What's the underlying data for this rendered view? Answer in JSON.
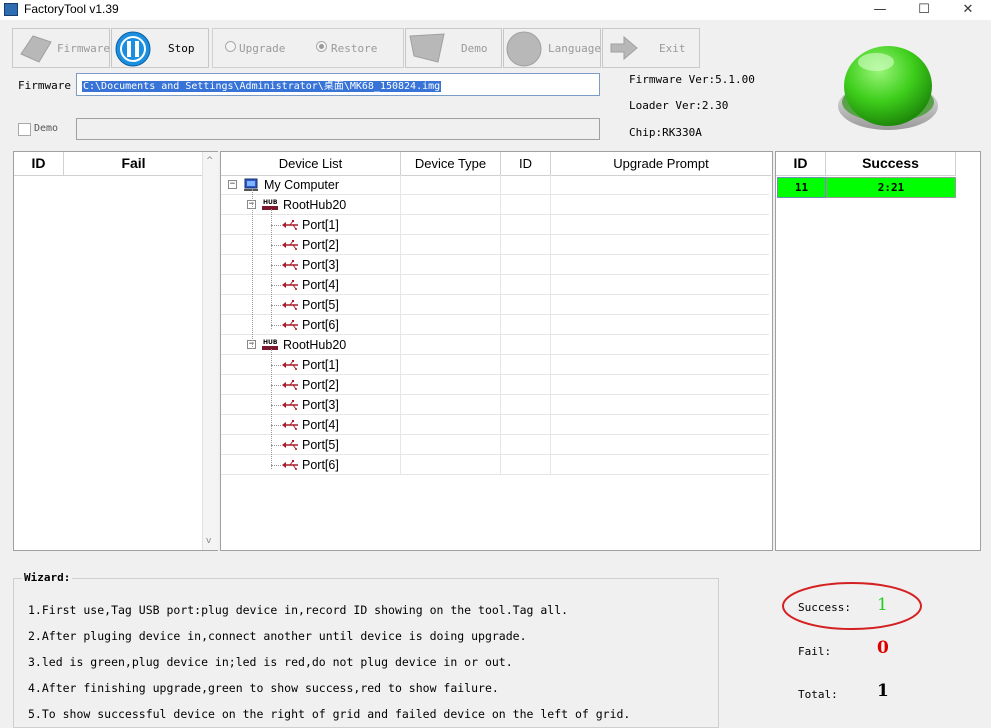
{
  "window": {
    "title": "FactoryTool v1.39",
    "minimize": "—",
    "maximize": "☐",
    "close": "✕"
  },
  "toolbar": {
    "firmware": "Firmware",
    "stop": "Stop",
    "upgrade": "Upgrade",
    "restore": "Restore",
    "demo": "Demo",
    "language": "Language",
    "exit": "Exit",
    "selected_mode": "Restore"
  },
  "firmware_field": {
    "label": "Firmware",
    "value": "C:\\Documents and Settings\\Administrator\\桌面\\MK68_150824.img"
  },
  "demo_field": {
    "label": "Demo",
    "checked": false,
    "value": ""
  },
  "info": {
    "firmware_ver": "Firmware Ver:5.1.00",
    "loader_ver": "Loader Ver:2.30",
    "chip": "Chip:RK330A"
  },
  "status_light": {
    "color": "#3fcf1c"
  },
  "fail_table": {
    "headers": [
      "ID",
      "Fail"
    ],
    "rows": []
  },
  "device_tree": {
    "headers": [
      "Device List",
      "Device Type",
      "ID",
      "Upgrade Prompt"
    ],
    "root": "My Computer",
    "hubs": [
      {
        "name": "RootHub20",
        "ports": [
          "Port[1]",
          "Port[2]",
          "Port[3]",
          "Port[4]",
          "Port[5]",
          "Port[6]"
        ]
      },
      {
        "name": "RootHub20",
        "ports": [
          "Port[1]",
          "Port[2]",
          "Port[3]",
          "Port[4]",
          "Port[5]",
          "Port[6]"
        ]
      }
    ],
    "hub_icon_text": "HUB"
  },
  "success_table": {
    "headers": [
      "ID",
      "Success"
    ],
    "rows": [
      {
        "id": "11",
        "time": "2:21"
      }
    ],
    "row_color": "#00ff00"
  },
  "wizard": {
    "title": "Wizard:",
    "lines": [
      "1.First use,Tag USB port:plug device in,record ID showing on the tool.Tag all.",
      "2.After pluging device in,connect another until device is doing upgrade.",
      "3.led is green,plug device in;led is red,do not plug device in or out.",
      "4.After finishing upgrade,green to show success,red to show failure.",
      "5.To show successful device on the right of grid and failed device on the left of grid."
    ]
  },
  "stats": {
    "success_label": "Success:",
    "success_value": "1",
    "success_color": "#22cc22",
    "fail_label": "Fail:",
    "fail_value": "0",
    "fail_color": "#dd0000",
    "total_label": "Total:",
    "total_value": "1",
    "highlight_color": "#d42020"
  }
}
